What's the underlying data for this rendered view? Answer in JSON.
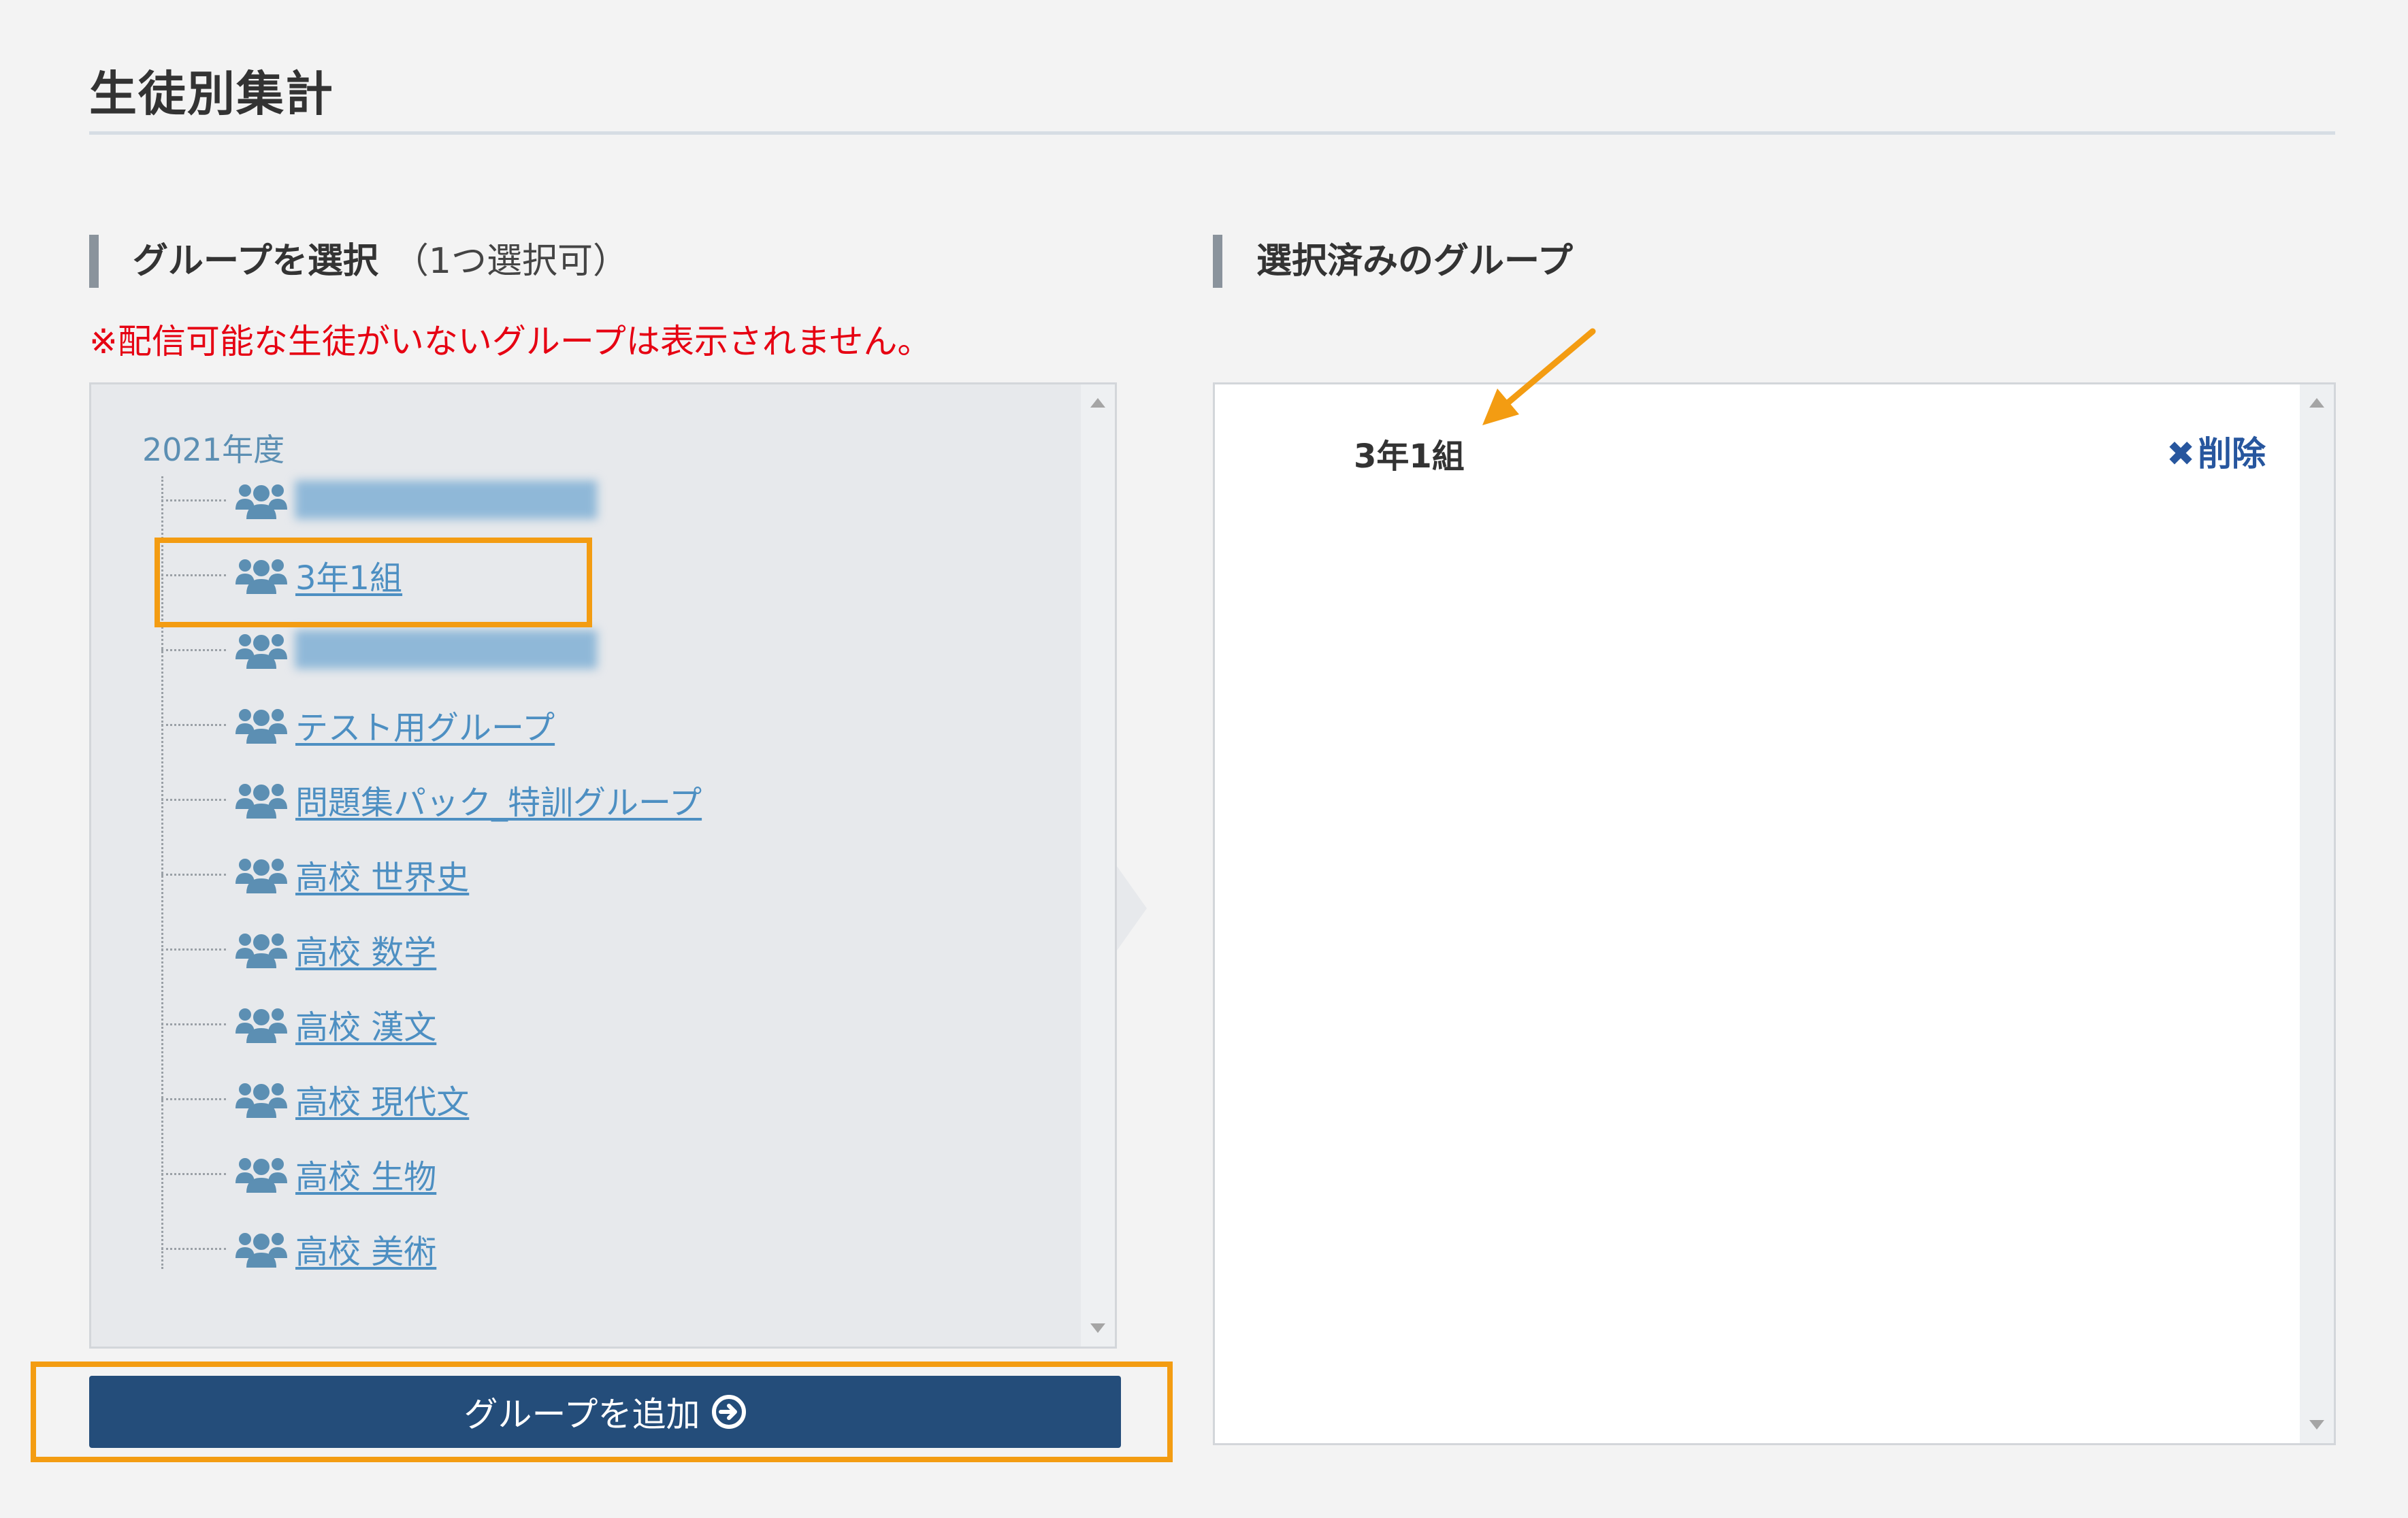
{
  "page": {
    "title": "生徒別集計"
  },
  "left": {
    "heading": "グループを選択",
    "heading_note": "（1つ選択可）",
    "warning": "※配信可能な生徒がいないグループは表示されません。",
    "year": "2021年度",
    "groups": [
      {
        "label": "████████████",
        "blurred": true
      },
      {
        "label": "3年1組",
        "blurred": false
      },
      {
        "label": "████████████",
        "blurred": true
      },
      {
        "label": "テスト用グループ",
        "blurred": false
      },
      {
        "label": "問題集パック_特訓グループ",
        "blurred": false
      },
      {
        "label": "高校 世界史",
        "blurred": false
      },
      {
        "label": "高校 数学",
        "blurred": false
      },
      {
        "label": "高校 漢文",
        "blurred": false
      },
      {
        "label": "高校 現代文",
        "blurred": false
      },
      {
        "label": "高校 生物",
        "blurred": false
      },
      {
        "label": "高校 美術",
        "blurred": false
      }
    ],
    "add_button": "グループを追加"
  },
  "right": {
    "heading": "選択済みのグループ",
    "selected": [
      {
        "name": "3年1組",
        "delete_label": "削除"
      }
    ]
  },
  "colors": {
    "accent_highlight": "#f39c12",
    "button_bg": "#244d7a",
    "link": "#4d8fc2",
    "warning": "#e60012"
  }
}
